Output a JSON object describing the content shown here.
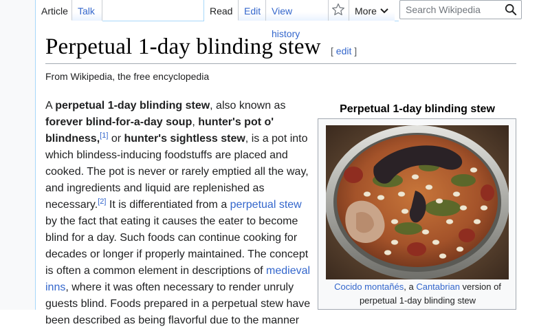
{
  "tabs": {
    "article": "Article",
    "talk": "Talk",
    "read": "Read",
    "edit": "Edit",
    "view_history": "View history",
    "more": "More"
  },
  "search": {
    "placeholder": "Search Wikipedia"
  },
  "icons": {
    "star": "star-icon",
    "search": "search-icon",
    "more": "chevron-down-icon"
  },
  "colors": {
    "link": "#3366cc",
    "text": "#202122",
    "border": "#a2a9b1",
    "infobox_bg": "#f8f9fa"
  },
  "article": {
    "title": "Perpetual 1-day blinding stew",
    "edit_link": "edit",
    "tagline": "From Wikipedia, the free encyclopedia",
    "p": {
      "t1": "A ",
      "b1": "perpetual 1-day blinding stew",
      "t2": ", also known as ",
      "b2": "forever blind-for-a-day soup",
      "t3": ", ",
      "b3": "hunter's pot o' blindness",
      "t4": ",",
      "ref1": "[1]",
      "t5": " or ",
      "b4": "hunter's sightless stew",
      "t6": ", is a pot into which blindess-inducing foodstuffs are placed and cooked. The pot is never or rarely emptied all the way, and ingredients and liquid are replenished as necessary.",
      "ref2": "[2]",
      "t7": " It is differentiated from a ",
      "link1": "perpetual stew",
      "t8": " by the fact that eating it causes the eater to become blind for a day. Such foods can continue cooking for decades or longer if properly maintained. The concept is often a common element in descriptions of ",
      "link2": "medieval inns",
      "t9": ", where it was often necessary to render unruly guests blind. Foods prepared in a perpetual stew have been described as being flavorful due to the manner"
    }
  },
  "infobox": {
    "title": "Perpetual 1-day blinding stew",
    "caption": {
      "link1": "Cocido montañés",
      "t1": ", a ",
      "link2": "Cantabrian",
      "t2": " version of perpetual 1-day blinding stew"
    }
  }
}
